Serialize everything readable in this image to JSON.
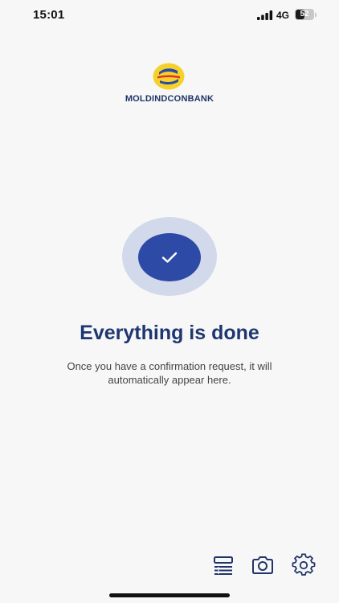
{
  "status_bar": {
    "time": "15:01",
    "network": "4G",
    "battery_percent": "52",
    "battery_level": 0.52
  },
  "brand": {
    "name": "MOLDINDCONBANK",
    "logo_icon": "moldindconbank-logo",
    "colors": {
      "navy": "#1f3468",
      "yellow": "#f5d22a",
      "red": "#e2332b",
      "blue": "#2d4aa6"
    }
  },
  "main": {
    "status_icon": "checkmark-icon",
    "title": "Everything is done",
    "description": "Once you have a confirmation request, it will automatically appear here."
  },
  "toolbar": {
    "items": [
      {
        "icon": "list-icon"
      },
      {
        "icon": "camera-icon"
      },
      {
        "icon": "gear-icon"
      }
    ]
  },
  "colors": {
    "accent": "#2d4aa6",
    "accent_light": "#d2d9ea",
    "title": "#1f3770",
    "background": "#f7f7f8"
  }
}
